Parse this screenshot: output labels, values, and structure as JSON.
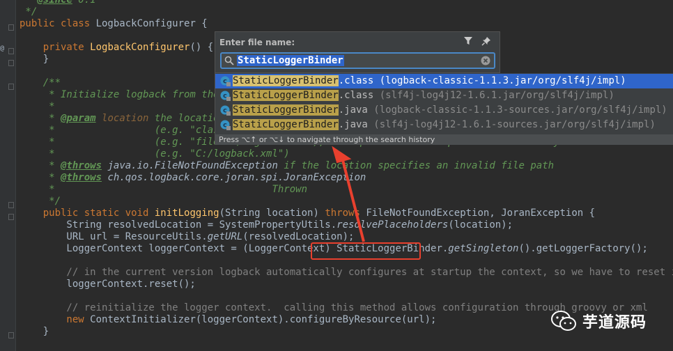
{
  "editor": {
    "lines": [
      {
        "segs": [
          {
            "t": " * ",
            "c": "cm"
          },
          {
            "t": "@since",
            "c": "tag"
          },
          {
            "t": " 0.1",
            "c": "cm"
          }
        ]
      },
      {
        "segs": [
          {
            "t": " */",
            "c": "cm"
          }
        ]
      },
      {
        "segs": [
          {
            "t": "public class ",
            "c": "kw"
          },
          {
            "t": "LogbackConfigurer {",
            "c": ""
          }
        ]
      },
      {
        "segs": []
      },
      {
        "segs": [
          {
            "t": "    private ",
            "c": "kw"
          },
          {
            "t": "LogbackConfigurer",
            "c": "fn"
          },
          {
            "t": "() {",
            "c": ""
          }
        ]
      },
      {
        "segs": [
          {
            "t": "    }",
            "c": ""
          }
        ]
      },
      {
        "segs": []
      },
      {
        "segs": [
          {
            "t": "    /**",
            "c": "cm"
          }
        ]
      },
      {
        "segs": [
          {
            "t": "     * Initialize logback from the ",
            "c": "cm"
          }
        ]
      },
      {
        "segs": [
          {
            "t": "     *",
            "c": "cm"
          }
        ]
      },
      {
        "segs": [
          {
            "t": "     * ",
            "c": "cm"
          },
          {
            "t": "@param",
            "c": "tag"
          },
          {
            "t": " ",
            "c": "cm"
          },
          {
            "t": "location",
            "c": "par"
          },
          {
            "t": " the location",
            "c": "cm"
          }
        ]
      },
      {
        "segs": [
          {
            "t": "     *                 (e.g. \"class",
            "c": "cm"
          }
        ]
      },
      {
        "segs": [
          {
            "t": "     *                 (e.g. \"file:C:/logback.xml\"), or a plain absolute path in the file system",
            "c": "cm"
          }
        ]
      },
      {
        "segs": [
          {
            "t": "     *                 (e.g. \"C:/logback.xml\")",
            "c": "cm"
          }
        ]
      },
      {
        "segs": [
          {
            "t": "     * ",
            "c": "cm"
          },
          {
            "t": "@throws",
            "c": "tag"
          },
          {
            "t": " java.io.FileNotFoundException",
            "c": "it"
          },
          {
            "t": " if the location specifies an invalid file path",
            "c": "cm"
          }
        ]
      },
      {
        "segs": [
          {
            "t": "     * ",
            "c": "cm"
          },
          {
            "t": "@throws",
            "c": "tag"
          },
          {
            "t": " ch.qos.logback.core.joran.spi.JoranException",
            "c": "it"
          }
        ]
      },
      {
        "segs": [
          {
            "t": "     *                                     Thrown",
            "c": "cm"
          }
        ]
      },
      {
        "segs": [
          {
            "t": "     */",
            "c": "cm"
          }
        ]
      },
      {
        "segs": [
          {
            "t": "    public static void ",
            "c": "kw"
          },
          {
            "t": "initLogging",
            "c": "fn"
          },
          {
            "t": "(String location) ",
            "c": ""
          },
          {
            "t": "throws ",
            "c": "kw"
          },
          {
            "t": "FileNotFoundException, JoranException {",
            "c": ""
          }
        ]
      },
      {
        "segs": [
          {
            "t": "        String resolvedLocation = SystemPropertyUtils.",
            "c": ""
          },
          {
            "t": "resolvePlaceholders",
            "c": "it"
          },
          {
            "t": "(location);",
            "c": ""
          }
        ]
      },
      {
        "segs": [
          {
            "t": "        URL url = ResourceUtils.",
            "c": ""
          },
          {
            "t": "getURL",
            "c": "it"
          },
          {
            "t": "(resolvedLocation);",
            "c": ""
          }
        ]
      },
      {
        "segs": [
          {
            "t": "        LoggerContext loggerContext = (LoggerContext) StaticLoggerBinder.",
            "c": ""
          },
          {
            "t": "getSingleton",
            "c": "it"
          },
          {
            "t": "().getLoggerFactory();",
            "c": ""
          }
        ]
      },
      {
        "segs": []
      },
      {
        "segs": [
          {
            "t": "        // in the current version logback automatically configures at startup the context, so we have to reset it",
            "c": "gray"
          }
        ]
      },
      {
        "segs": [
          {
            "t": "        loggerContext.reset();",
            "c": ""
          }
        ]
      },
      {
        "segs": []
      },
      {
        "segs": [
          {
            "t": "        // reinitialize the logger context.  calling this method allows configuration through groovy or xml",
            "c": "gray"
          }
        ]
      },
      {
        "segs": [
          {
            "t": "        new ",
            "c": "kw"
          },
          {
            "t": "ContextInitializer(loggerContext).configureByResource(url);",
            "c": ""
          }
        ]
      },
      {
        "segs": [
          {
            "t": "    }",
            "c": ""
          }
        ]
      }
    ]
  },
  "popup": {
    "title": "Enter file name:",
    "search_value": "StaticLoggerBinder",
    "results": [
      {
        "match": "StaticLoggerBinder",
        "rest": ".class ",
        "location": "(logback-classic-1.1.3.jar/org/slf4j/impl)",
        "selected": true
      },
      {
        "match": "StaticLoggerBinder",
        "rest": ".class ",
        "location": "(slf4j-log4j12-1.6.1.jar/org/slf4j/impl)",
        "selected": false
      },
      {
        "match": "StaticLoggerBinder",
        "rest": ".java ",
        "location": "(logback-classic-1.1.3-sources.jar/org/slf4j/impl)   Mav",
        "selected": false
      },
      {
        "match": "StaticLoggerBinder",
        "rest": ".java ",
        "location": "(slf4j-log4j12-1.6.1-sources.jar/org/slf4j/impl)",
        "selected": false
      }
    ],
    "hint": "Press ⌥↑ or ⌥↓ to navigate through the search history"
  },
  "watermark": {
    "text": "芋道源码"
  },
  "colors": {
    "accent": "#2f65ca",
    "callout": "#e8402e",
    "background": "#2b2b2b"
  }
}
